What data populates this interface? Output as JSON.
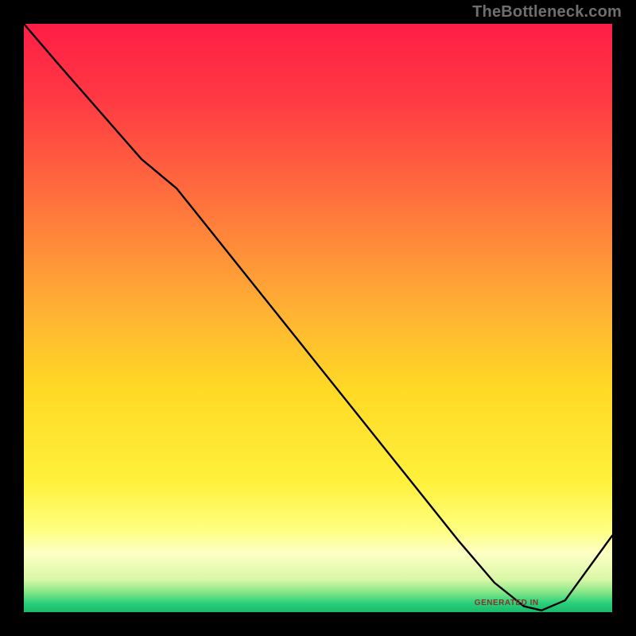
{
  "watermark": "TheBottleneck.com",
  "chart_data": {
    "type": "line",
    "title": "",
    "xlabel": "",
    "ylabel": "",
    "xlim": [
      0,
      100
    ],
    "ylim": [
      0,
      100
    ],
    "grid": false,
    "legend_position": "inline",
    "background_gradient": {
      "stops": [
        {
          "pos": 0.0,
          "color": "#ff1e46"
        },
        {
          "pos": 0.12,
          "color": "#ff3744"
        },
        {
          "pos": 0.28,
          "color": "#ff6a3e"
        },
        {
          "pos": 0.48,
          "color": "#ffaf34"
        },
        {
          "pos": 0.62,
          "color": "#ffd924"
        },
        {
          "pos": 0.78,
          "color": "#fff13c"
        },
        {
          "pos": 0.86,
          "color": "#ffff80"
        },
        {
          "pos": 0.9,
          "color": "#fdffc4"
        },
        {
          "pos": 0.945,
          "color": "#d8f7a6"
        },
        {
          "pos": 0.965,
          "color": "#8ae78a"
        },
        {
          "pos": 0.985,
          "color": "#28d07a"
        },
        {
          "pos": 1.0,
          "color": "#1bb86a"
        }
      ]
    },
    "series": [
      {
        "name": "GENERATED IN",
        "color": "#000000",
        "x": [
          0,
          6,
          13,
          20,
          26,
          38,
          50,
          62,
          74,
          80,
          85,
          88,
          92,
          100
        ],
        "values": [
          100,
          93,
          85,
          77,
          72,
          57,
          42,
          27,
          12,
          5,
          1,
          0.3,
          2,
          13
        ]
      }
    ],
    "annotations": [
      {
        "text": "GENERATED IN",
        "x": 82,
        "y": 1.5,
        "color": "#8c2f2f"
      }
    ]
  }
}
